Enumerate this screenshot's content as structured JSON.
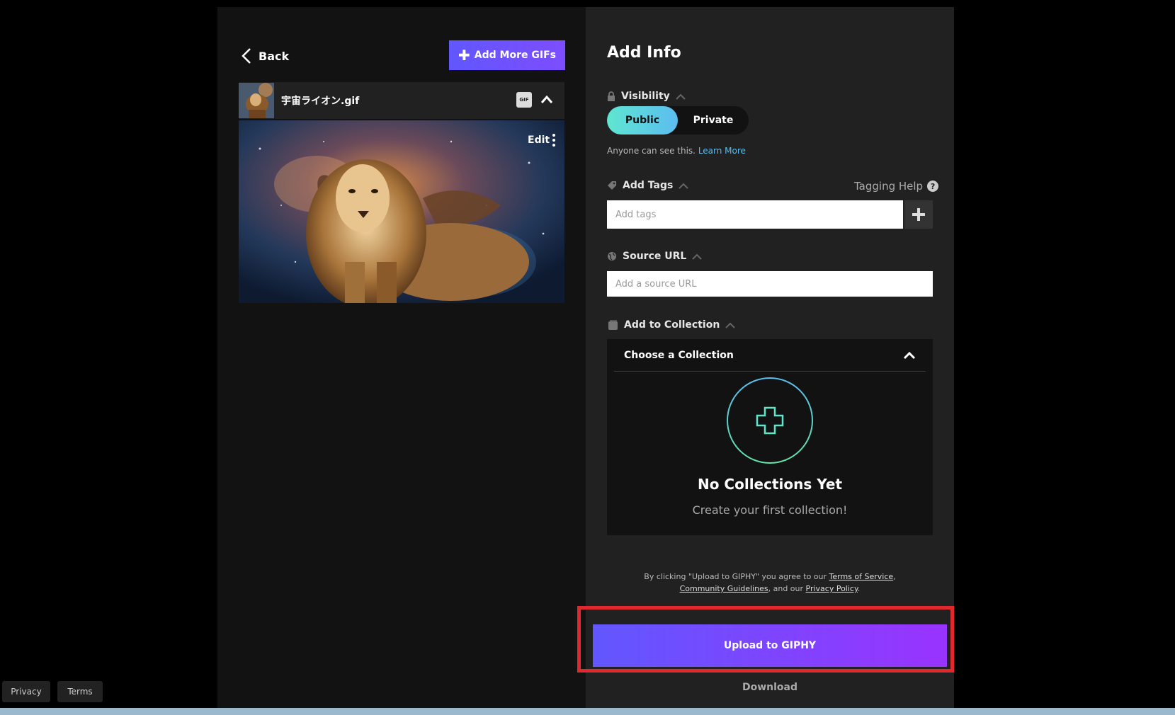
{
  "left": {
    "back_label": "Back",
    "add_more_label": "Add More GIFs",
    "file_name": "宇宙ライオン.gif",
    "gif_badge": "GIF",
    "edit_label": "Edit"
  },
  "right": {
    "title": "Add Info",
    "visibility": {
      "label": "Visibility",
      "public_label": "Public",
      "private_label": "Private",
      "selected": "Public",
      "note": "Anyone can see this.",
      "learn_more": "Learn More"
    },
    "tags": {
      "label": "Add Tags",
      "help_label": "Tagging Help",
      "help_glyph": "?",
      "placeholder": "Add tags"
    },
    "source": {
      "label": "Source URL",
      "placeholder": "Add a source URL"
    },
    "collection": {
      "label": "Add to Collection",
      "choose_label": "Choose a Collection",
      "empty_title": "No Collections Yet",
      "empty_subtitle": "Create your first collection!"
    },
    "legal": {
      "prefix": "By clicking \"Upload to GIPHY\" you agree to our ",
      "terms": "Terms of Service",
      "comma": ",",
      "guidelines": "Community Guidelines",
      "middle": ", and our ",
      "privacy": "Privacy Policy",
      "end": "."
    },
    "upload_label": "Upload to GIPHY",
    "download_label": "Download"
  },
  "footer": {
    "privacy": "Privacy",
    "terms": "Terms"
  },
  "colors": {
    "accent_purple": "#6157ff",
    "accent_teal": "#5fe6d1",
    "highlight_red": "#e0282f"
  }
}
